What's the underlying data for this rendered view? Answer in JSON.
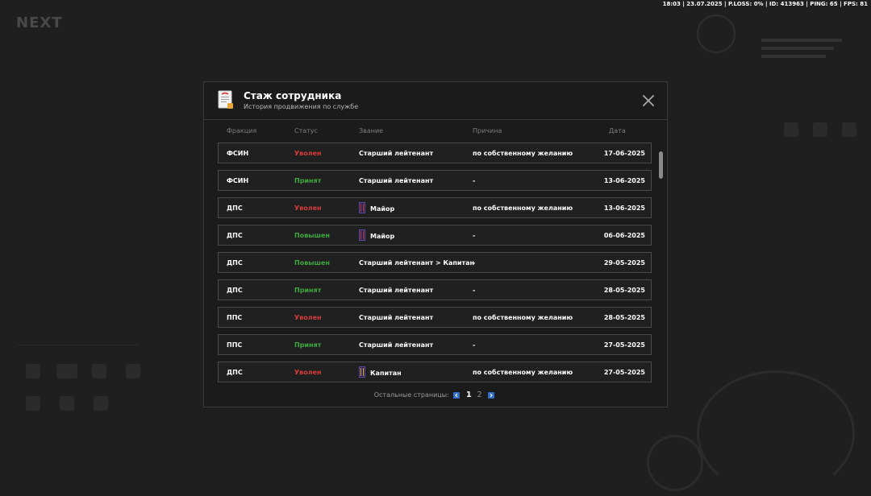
{
  "status_bar": "18:03 | 23.07.2025 | P.LOSS: 0% | ID: 413963 | PING: 65 | FPS: 81",
  "colors": {
    "dismissed": "#d63c3c",
    "hired": "#3ea83e",
    "accent": "#2f6dc8"
  },
  "modal": {
    "title": "Стаж сотрудника",
    "subtitle": "История продвижения по службе",
    "icon": "document-icon",
    "close_icon": "close-icon"
  },
  "columns": {
    "faction": "Фракция",
    "status": "Статус",
    "rank": "Звание",
    "reason": "Причина",
    "date": "Дата"
  },
  "rows": [
    {
      "faction": "ФСИН",
      "status": "Уволен",
      "status_type": "red",
      "rank": "Старший лейтенант",
      "rank_icon": "",
      "reason": "по собственному желанию",
      "date": "17-06-2025"
    },
    {
      "faction": "ФСИН",
      "status": "Принят",
      "status_type": "green",
      "rank": "Старший лейтенант",
      "rank_icon": "",
      "reason": "-",
      "date": "13-06-2025"
    },
    {
      "faction": "ДПС",
      "status": "Уволен",
      "status_type": "red",
      "rank": "Майор",
      "rank_icon": "major-shoulder-strap-icon",
      "reason": "по собственному желанию",
      "date": "13-06-2025"
    },
    {
      "faction": "ДПС",
      "status": "Повышен",
      "status_type": "green",
      "rank": "Майор",
      "rank_icon": "major-shoulder-strap-icon",
      "reason": "-",
      "date": "06-06-2025"
    },
    {
      "faction": "ДПС",
      "status": "Повышен",
      "status_type": "green",
      "rank": "Старший лейтенант > Капитан",
      "rank_icon": "",
      "reason": "-",
      "date": "29-05-2025"
    },
    {
      "faction": "ДПС",
      "status": "Принят",
      "status_type": "green",
      "rank": "Старший лейтенант",
      "rank_icon": "",
      "reason": "-",
      "date": "28-05-2025"
    },
    {
      "faction": "ППС",
      "status": "Уволен",
      "status_type": "red",
      "rank": "Старший лейтенант",
      "rank_icon": "",
      "reason": "по собственному желанию",
      "date": "28-05-2025"
    },
    {
      "faction": "ППС",
      "status": "Принят",
      "status_type": "green",
      "rank": "Старший лейтенант",
      "rank_icon": "",
      "reason": "-",
      "date": "27-05-2025"
    },
    {
      "faction": "ДПС",
      "status": "Уволен",
      "status_type": "red",
      "rank": "Капитан",
      "rank_icon": "captain-shoulder-strap-icon",
      "reason": "по собственному желанию",
      "date": "27-05-2025"
    }
  ],
  "pagination": {
    "label": "Остальные страницы:",
    "pages": [
      "1",
      "2"
    ],
    "current": "1"
  }
}
